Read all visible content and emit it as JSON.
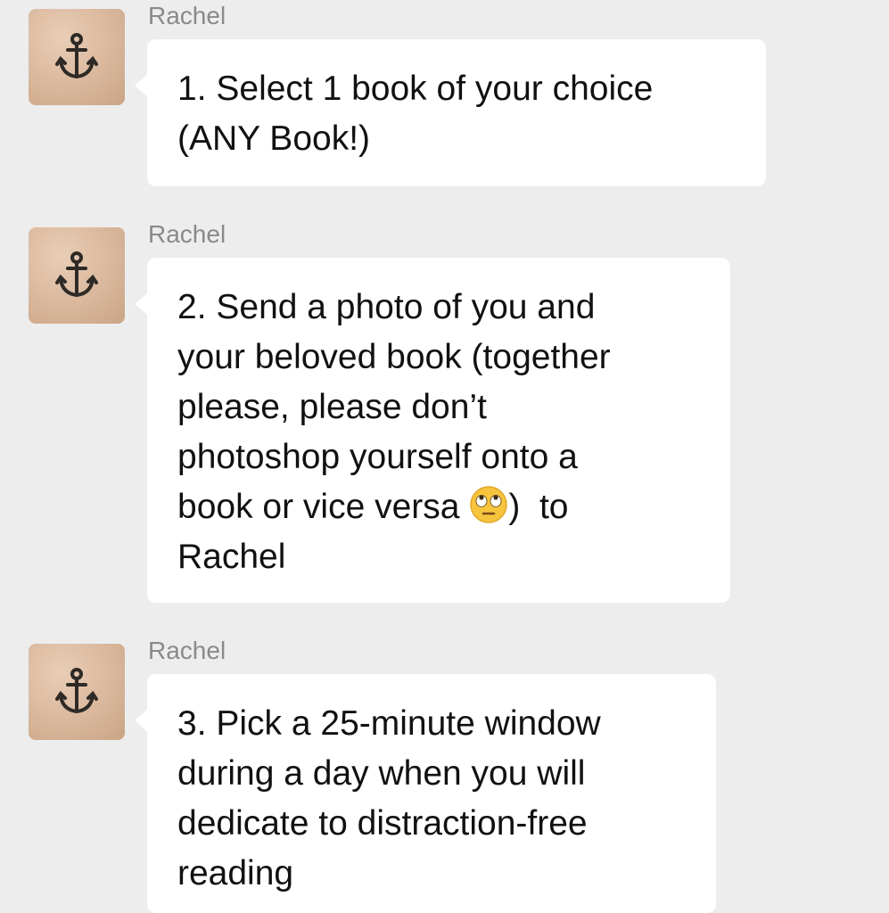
{
  "messages": [
    {
      "sender": "Rachel",
      "avatar_icon": "anchor-icon",
      "lines": [
        "1. Select 1 book of your choice",
        "(ANY Book!)"
      ]
    },
    {
      "sender": "Rachel",
      "avatar_icon": "anchor-icon",
      "lines": [
        "2. Send a photo of you and",
        "your beloved book (together",
        "please, please don’t",
        "photoshop yourself onto a"
      ],
      "line5_before_emoji": "book or vice versa ",
      "emoji": "face-with-rolling-eyes-emoji",
      "line5_after_emoji": ")  to",
      "last_line": "Rachel"
    },
    {
      "sender": "Rachel",
      "avatar_icon": "anchor-icon",
      "lines": [
        "3. Pick a 25-minute window",
        "during a day when you will",
        "dedicate to distraction-free",
        "reading"
      ]
    }
  ],
  "colors": {
    "background": "#ededed",
    "bubble": "#ffffff",
    "sender_text": "#8a8a8a",
    "message_text": "#111111",
    "avatar_bg": "#d9b79c"
  }
}
